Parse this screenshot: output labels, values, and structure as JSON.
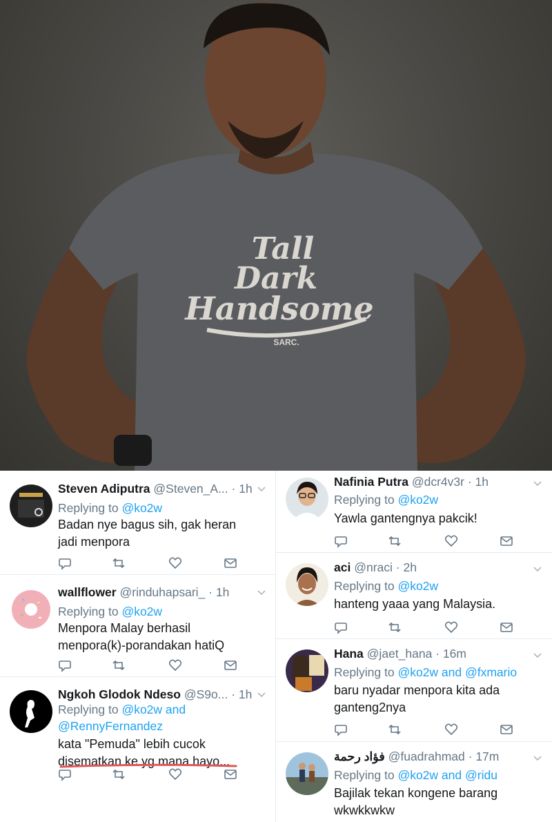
{
  "photo": {
    "shirt_line1": "Tall",
    "shirt_line2": "Dark",
    "shirt_line3": "Handsome",
    "shirt_brand": "SARC."
  },
  "tweets_left": [
    {
      "name": "Steven Adiputra",
      "handle": "@Steven_A...",
      "time": "· 1h",
      "reply_prefix": "Replying to",
      "reply_to": "@ko2w",
      "reply_to2": "",
      "body_line1": "Badan nye bagus sih, gak heran",
      "body_line2": "jadi menpora",
      "avatar": "taurus-avatar"
    },
    {
      "name": "wallflower",
      "handle": "@rinduhapsari_",
      "time": "· 1h",
      "reply_prefix": "Replying to",
      "reply_to": "@ko2w",
      "reply_to2": "",
      "body_line1": "Menpora Malay berhasil",
      "body_line2": "menpora(k)-porandakan hatiQ",
      "avatar": "donut-avatar"
    },
    {
      "name": "Ngkoh Glodok Ndeso",
      "handle": "@S9o...",
      "time": "· 1h",
      "reply_prefix": "Replying to",
      "reply_to": "@ko2w and",
      "reply_to2": "@RennyFernandez",
      "body_line1": "kata \"Pemuda\" lebih cucok",
      "body_line2": "disematkan ke yg mana hayo...",
      "avatar": "silhouette-avatar"
    }
  ],
  "tweets_right": [
    {
      "name": "Nafinia Putra",
      "handle": "@dcr4v3r",
      "time": "· 1h",
      "reply_prefix": "Replying to",
      "reply_to": "@ko2w",
      "body_line1": "Yawla gantengnya pakcik!",
      "body_line2": "",
      "avatar": "woman-glasses-avatar"
    },
    {
      "name": "aci",
      "handle": "@nraci",
      "time": "· 2h",
      "reply_prefix": "Replying to",
      "reply_to": "@ko2w",
      "body_line1": "hanteng yaaa yang Malaysia.",
      "body_line2": "",
      "avatar": "woman-smile-avatar"
    },
    {
      "name": "Hana",
      "handle": "@jaet_hana",
      "time": "· 16m",
      "reply_prefix": "Replying to",
      "reply_to": "@ko2w and @fxmario",
      "body_line1": "baru nyadar menpora kita ada",
      "body_line2": "ganteng2nya",
      "avatar": "anime-avatar"
    },
    {
      "name": "فؤاد رحمة",
      "handle": "@fuadrahmad",
      "time": "· 17m",
      "reply_prefix": "Replying to",
      "reply_to": "@ko2w and @ridu",
      "body_line1": "Bajilak tekan kongene barang",
      "body_line2": "wkwkkwkw",
      "avatar": "outdoor-couple-avatar"
    }
  ],
  "colors": {
    "link": "#1da1f2",
    "muted": "#657786",
    "text": "#14171a",
    "divider": "#e6ecf0",
    "underline_marker": "#e05555"
  }
}
